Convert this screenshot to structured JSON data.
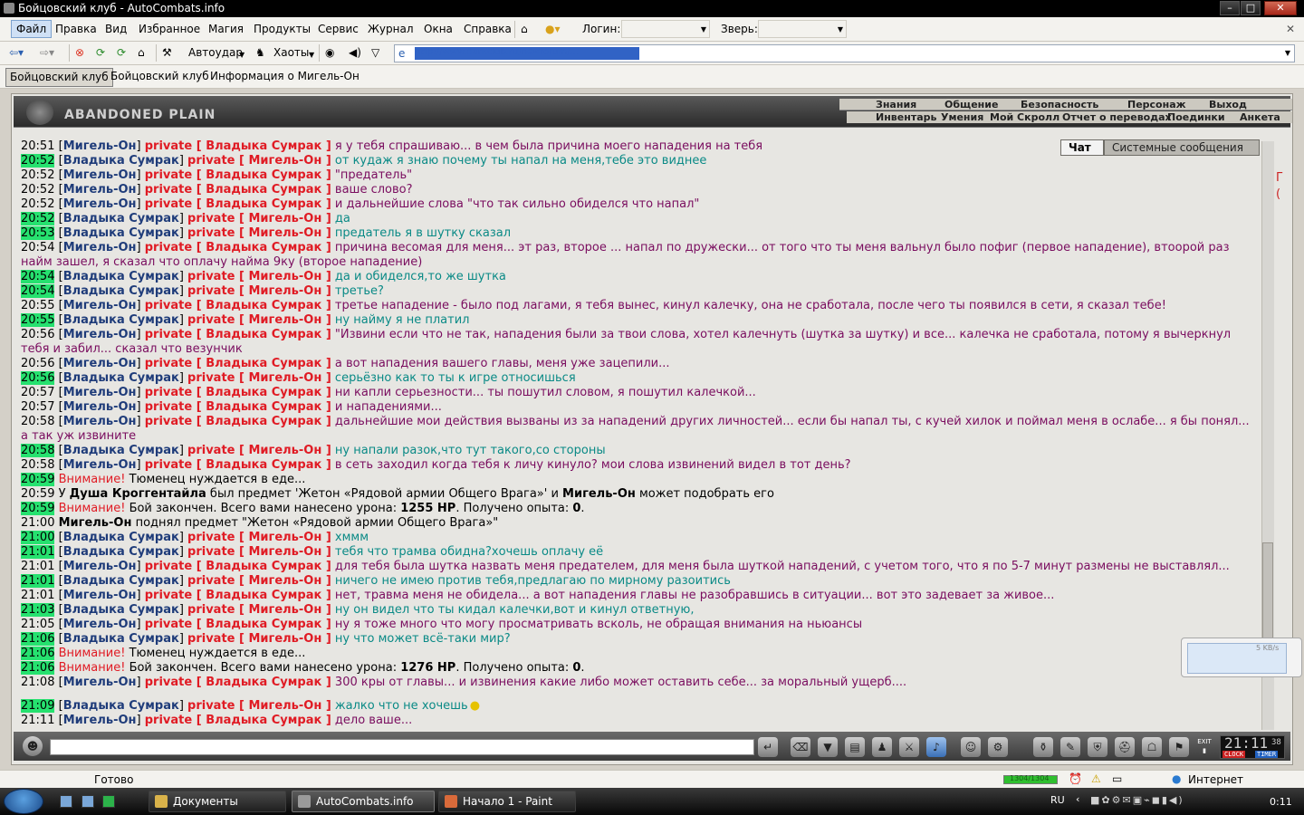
{
  "window": {
    "title": "Бойцовский клуб - AutoCombats.info",
    "min": "–",
    "max": "□",
    "close": "✕"
  },
  "menu": {
    "items": [
      "Файл",
      "Правка",
      "Вид",
      "Избранное",
      "Магия",
      "Продукты",
      "Сервис",
      "Журнал",
      "Окна",
      "Справка"
    ],
    "login_label": "Логин:",
    "login_value": "",
    "beast_label": "Зверь:",
    "beast_value": ""
  },
  "toolbar": {
    "autoattack": "Автоудар",
    "chaots": "Хаоты",
    "address_value": "http://www.darkclub.ru/newforum/..."
  },
  "tabs": [
    "Бойцовский клуб",
    "Бойцовский клуб",
    "Информация о Мигель-Он"
  ],
  "game": {
    "logo": "ABANDONED PLAIN",
    "nav1": [
      "Знания",
      "Общение",
      "Безопасность",
      "Персонаж",
      "Выход"
    ],
    "nav2": [
      "Инвентарь",
      "Умения",
      "Мой Скролл",
      "Отчет о переводах",
      "Поединки",
      "Анкета"
    ],
    "chat_tabs": [
      "Чат",
      "Системные сообщения"
    ]
  },
  "chat": [
    {
      "t": "20:51",
      "hi": false,
      "k": "pm",
      "a": "Мигель-Он",
      "b": "Владыка Сумрак",
      "x": "я у тебя спрашиваю... в чем была причина моего нападения на тебя",
      "c": 1
    },
    {
      "t": "20:52",
      "hi": true,
      "k": "pm",
      "a": "Владыка Сумрак",
      "b": "Мигель-Он",
      "x": "от кудаж я знаю почему ты напал на меня,тебе это виднее",
      "c": 2
    },
    {
      "t": "20:52",
      "hi": false,
      "k": "pm",
      "a": "Мигель-Он",
      "b": "Владыка Сумрак",
      "x": "\"предатель\"",
      "c": 1
    },
    {
      "t": "20:52",
      "hi": false,
      "k": "pm",
      "a": "Мигель-Он",
      "b": "Владыка Сумрак",
      "x": "ваше слово?",
      "c": 1
    },
    {
      "t": "20:52",
      "hi": false,
      "k": "pm",
      "a": "Мигель-Он",
      "b": "Владыка Сумрак",
      "x": "и дальнейшие слова \"что так сильно обиделся что напал\"",
      "c": 1
    },
    {
      "t": "20:52",
      "hi": true,
      "k": "pm",
      "a": "Владыка Сумрак",
      "b": "Мигель-Он",
      "x": "да",
      "c": 2
    },
    {
      "t": "20:53",
      "hi": true,
      "k": "pm",
      "a": "Владыка Сумрак",
      "b": "Мигель-Он",
      "x": "предатель я в шутку сказал",
      "c": 2
    },
    {
      "t": "20:54",
      "hi": false,
      "k": "pm",
      "a": "Мигель-Он",
      "b": "Владыка Сумрак",
      "x": "причина весомая для меня... эт раз, второе ... напал по дружески... от того что ты меня вальнул было пофиг (первое нападение), втоорой раз найм зашел, я сказал что оплачу найма 9ку (второе нападение)",
      "c": 1
    },
    {
      "t": "20:54",
      "hi": true,
      "k": "pm",
      "a": "Владыка Сумрак",
      "b": "Мигель-Он",
      "x": "да и обиделся,то же шутка",
      "c": 2
    },
    {
      "t": "20:54",
      "hi": true,
      "k": "pm",
      "a": "Владыка Сумрак",
      "b": "Мигель-Он",
      "x": "третье?",
      "c": 2
    },
    {
      "t": "20:55",
      "hi": false,
      "k": "pm",
      "a": "Мигель-Он",
      "b": "Владыка Сумрак",
      "x": "третье нападение - было под лагами, я тебя вынес, кинул калечку, она не сработала, после чего ты появился в сети, я сказал тебе!",
      "c": 1
    },
    {
      "t": "20:55",
      "hi": true,
      "k": "pm",
      "a": "Владыка Сумрак",
      "b": "Мигель-Он",
      "x": "ну найму я не платил",
      "c": 2
    },
    {
      "t": "20:56",
      "hi": false,
      "k": "pm",
      "a": "Мигель-Он",
      "b": "Владыка Сумрак",
      "x": "\"Извини если что не так, нападения были за твои слова, хотел калечнуть (шутка за шутку) и все... калечка не сработала, потому я вычеркнул тебя и забил... сказал что везунчик",
      "c": 1
    },
    {
      "t": "20:56",
      "hi": false,
      "k": "pm",
      "a": "Мигель-Он",
      "b": "Владыка Сумрак",
      "x": "а вот нападения вашего главы, меня уже зацепили...",
      "c": 1
    },
    {
      "t": "20:56",
      "hi": true,
      "k": "pm",
      "a": "Владыка Сумрак",
      "b": "Мигель-Он",
      "x": "серьёзно как то ты к игре относишься",
      "c": 2
    },
    {
      "t": "20:57",
      "hi": false,
      "k": "pm",
      "a": "Мигель-Он",
      "b": "Владыка Сумрак",
      "x": "ни капли серьезности... ты пошутил словом, я пошутил калечкой...",
      "c": 1
    },
    {
      "t": "20:57",
      "hi": false,
      "k": "pm",
      "a": "Мигель-Он",
      "b": "Владыка Сумрак",
      "x": "и нападениями...",
      "c": 1
    },
    {
      "t": "20:58",
      "hi": false,
      "k": "pm",
      "a": "Мигель-Он",
      "b": "Владыка Сумрак",
      "x": "дальнейшие мои действия вызваны из за нападений других личностей... если бы напал ты, с кучей хилок и поймал меня в ослабе... я бы понял... а так уж извините",
      "c": 1
    },
    {
      "t": "20:58",
      "hi": true,
      "k": "pm",
      "a": "Владыка Сумрак",
      "b": "Мигель-Он",
      "x": "ну напали разок,что тут такого,со стороны",
      "c": 2
    },
    {
      "t": "20:58",
      "hi": false,
      "k": "pm",
      "a": "Мигель-Он",
      "b": "Владыка Сумрак",
      "x": "в сеть заходил когда тебя к личу кинуло? мои слова извинений видел в тот день?",
      "c": 1
    },
    {
      "t": "20:59",
      "hi": true,
      "k": "sys",
      "w": "Внимание!",
      "x": "Тюменец нуждается в еде..."
    },
    {
      "t": "20:59",
      "hi": false,
      "k": "drop",
      "p1": "У ",
      "n1": "Душа Кроггентайла",
      "p2": " был предмет 'Жетон «Рядовой армии Общего Врага»' и ",
      "n2": "Мигель-Он",
      "p3": " может подобрать его"
    },
    {
      "t": "20:59",
      "hi": true,
      "k": "fight",
      "w": "Внимание!",
      "p1": "Бой закончен. Всего вами нанесено урона: ",
      "d": "1255 HP",
      "p2": ". Получено опыта: ",
      "e": "0",
      "p3": "."
    },
    {
      "t": "21:00",
      "hi": false,
      "k": "pick",
      "n": "Мигель-Он",
      "x": "поднял предмет \"Жетон «Рядовой армии Общего Врага»\""
    },
    {
      "t": "21:00",
      "hi": true,
      "k": "pm",
      "a": "Владыка Сумрак",
      "b": "Мигель-Он",
      "x": "хммм",
      "c": 2
    },
    {
      "t": "21:01",
      "hi": true,
      "k": "pm",
      "a": "Владыка Сумрак",
      "b": "Мигель-Он",
      "x": "тебя что трамва обидна?хочешь оплачу её",
      "c": 2
    },
    {
      "t": "21:01",
      "hi": false,
      "k": "pm",
      "a": "Мигель-Он",
      "b": "Владыка Сумрак",
      "x": "для тебя была шутка назвать меня предателем, для меня была шуткой нападений, с учетом того, что я по 5-7 минут размены не выставлял...",
      "c": 1
    },
    {
      "t": "21:01",
      "hi": true,
      "k": "pm",
      "a": "Владыка Сумрак",
      "b": "Мигель-Он",
      "x": "ничего не имею против тебя,предлагаю по мирному разоитись",
      "c": 2
    },
    {
      "t": "21:01",
      "hi": false,
      "k": "pm",
      "a": "Мигель-Он",
      "b": "Владыка Сумрак",
      "x": "нет, травма меня не обидела... а вот нападения главы не разобравшись в ситуации... вот это задевает за живое...",
      "c": 1
    },
    {
      "t": "21:03",
      "hi": true,
      "k": "pm",
      "a": "Владыка Сумрак",
      "b": "Мигель-Он",
      "x": "ну он видел что ты кидал калечки,вот и кинул ответную,",
      "c": 2
    },
    {
      "t": "21:05",
      "hi": false,
      "k": "pm",
      "a": "Мигель-Он",
      "b": "Владыка Сумрак",
      "x": "ну я тоже много что могу просматривать всколь, не обращая внимания на ньюансы",
      "c": 1
    },
    {
      "t": "21:06",
      "hi": true,
      "k": "pm",
      "a": "Владыка Сумрак",
      "b": "Мигель-Он",
      "x": "ну что может всё-таки мир?",
      "c": 2
    },
    {
      "t": "21:06",
      "hi": true,
      "k": "sys",
      "w": "Внимание!",
      "x": "Тюменец нуждается в еде..."
    },
    {
      "t": "21:06",
      "hi": true,
      "k": "fight",
      "w": "Внимание!",
      "p1": "Бой закончен. Всего вами нанесено урона: ",
      "d": "1276 HP",
      "p2": ". Получено опыта: ",
      "e": "0",
      "p3": "."
    },
    {
      "t": "21:08",
      "hi": false,
      "k": "pm",
      "a": "Мигель-Он",
      "b": "Владыка Сумрак",
      "x": "300 кры от главы... и извинения какие либо может оставить себе... за моральный ущерб....",
      "c": 1
    },
    {
      "t": "21:09",
      "hi": true,
      "k": "pm",
      "a": "Владыка Сумрак",
      "b": "Мигель-Он",
      "x": "жалко что не хочешь",
      "c": 2
    },
    {
      "t": "21:11",
      "hi": false,
      "k": "pm",
      "a": "Мигель-Он",
      "b": "Владыка Сумрак",
      "x": "дело ваше...",
      "c": 1
    }
  ],
  "private_word": "private",
  "clock": {
    "time": "21:11",
    "sec": "38",
    "clock_label": "CLOCK",
    "timer_label": "TIMER",
    "exit_label": "EXIT"
  },
  "net": {
    "speed": "5 KB/s"
  },
  "status": {
    "text": "Готово",
    "progress_text": "1304/1304",
    "progress": 1.0,
    "zone": "Интернет"
  },
  "taskbar": {
    "items": [
      "Документы",
      "AutoCombats.info",
      "Начало 1 - Paint"
    ],
    "lang": "RU",
    "time": "0:11"
  },
  "colors": {
    "highlight_time": "#26e16f",
    "private": "#e01b24",
    "text_from_me": "#7a0d5f",
    "text_to_me": "#0a8a86",
    "nick": "#1f3c7a"
  }
}
